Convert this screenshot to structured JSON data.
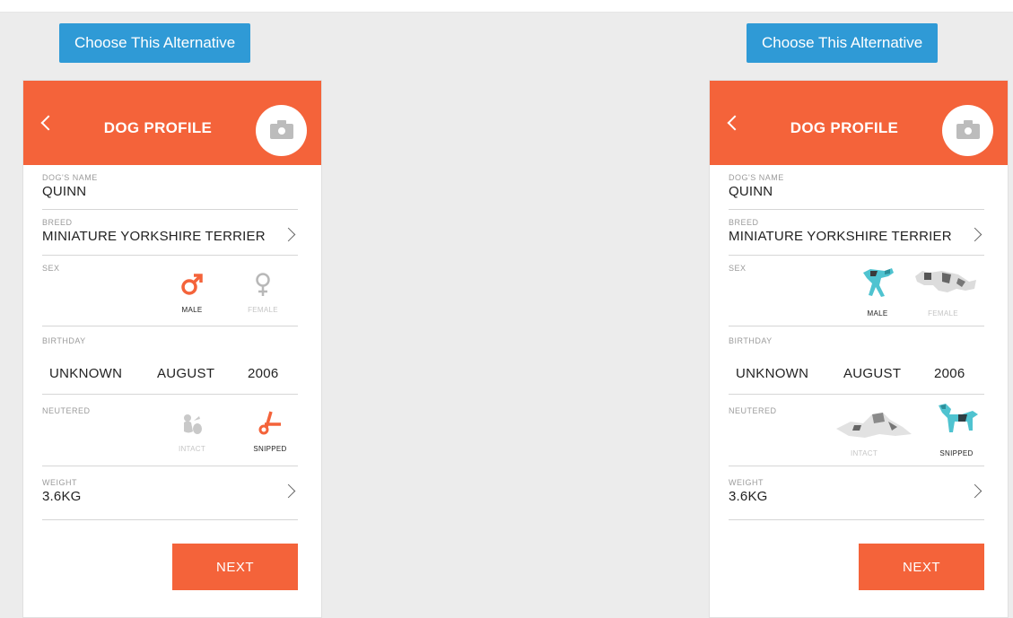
{
  "choose_label": "Choose This Alternative",
  "header": {
    "title": "DOG PROFILE"
  },
  "fields": {
    "name_label": "DOG'S NAME",
    "name_value": "QUINN",
    "breed_label": "BREED",
    "breed_value": "MINIATURE YORKSHIRE TERRIER",
    "sex_label": "SEX",
    "male_label": "MALE",
    "female_label": "FEMALE",
    "birthday_label": "BIRTHDAY",
    "birthday_day": "UNKNOWN",
    "birthday_month": "AUGUST",
    "birthday_year": "2006",
    "neutered_label": "NEUTERED",
    "intact_label": "INTACT",
    "snipped_label": "SNIPPED",
    "weight_label": "WEIGHT",
    "weight_value": "3.6KG"
  },
  "next_label": "NEXT",
  "colors": {
    "accent": "#f4633a",
    "button_blue": "#2f9ad6",
    "dog_teal": "#4fc3d0"
  },
  "variants": {
    "left": "symbol-icons",
    "right": "dog-illustration-icons"
  }
}
